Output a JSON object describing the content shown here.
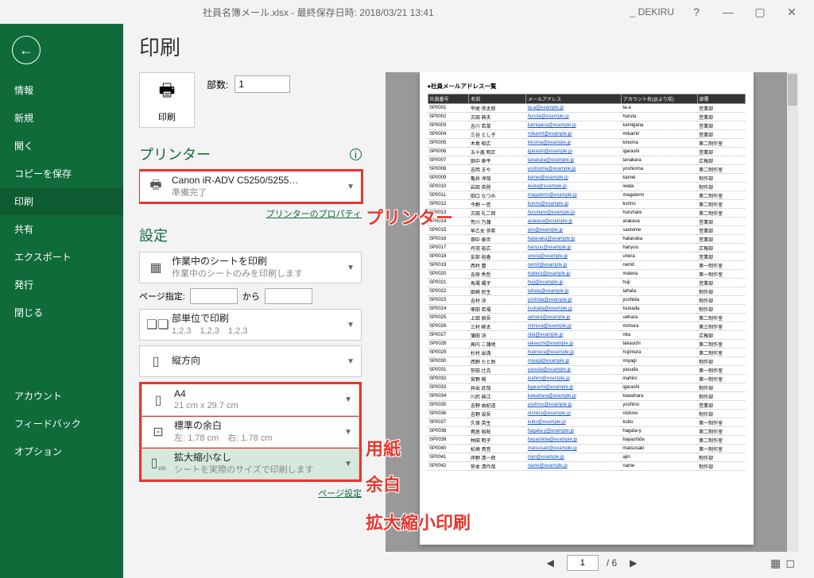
{
  "titlebar": {
    "title": "社員名簿メール.xlsx - 最終保存日時: 2018/03/21 13:41",
    "user": "_ DEKIRU",
    "help": "?"
  },
  "sidebar": {
    "items": [
      "情報",
      "新規",
      "開く",
      "コピーを保存",
      "印刷",
      "共有",
      "エクスポート",
      "発行",
      "閉じる"
    ],
    "bottom": [
      "アカウント",
      "フィードバック",
      "オプション"
    ]
  },
  "page": {
    "title": "印刷",
    "print_btn": "印刷",
    "copies_label": "部数:",
    "copies_value": "1",
    "printer_label": "プリンター",
    "printer": {
      "name": "Canon iR-ADV C5250/5255…",
      "status": "準備完了"
    },
    "printer_props": "プリンターのプロパティ",
    "settings_label": "設定",
    "sheet": {
      "t1": "作業中のシートを印刷",
      "t2": "作業中のシートのみを印刷します"
    },
    "page_spec_label": "ページ指定:",
    "page_spec_to": "から",
    "collate": {
      "t1": "部単位で印刷",
      "t2": "1,2,3　1,2,3　1,2,3"
    },
    "orient": {
      "t1": "縦方向"
    },
    "paper": {
      "t1": "A4",
      "t2": "21 cm x 29.7 cm"
    },
    "margin": {
      "t1": "標準の余白",
      "t2": "左: 1.78 cm　右: 1.78 cm"
    },
    "scale": {
      "t1": "拡大縮小なし",
      "t2": "シートを実際のサイズで印刷します"
    },
    "page_setup": "ページ設定"
  },
  "annotations": {
    "printer": "プリンター",
    "paper": "用紙",
    "margin": "余白",
    "scale": "拡大縮小印刷"
  },
  "preview": {
    "title": "●社員メールアドレス一覧",
    "headers": [
      "社員番号",
      "名前",
      "メールアドレス",
      "アカウント名(@より前)",
      "部署"
    ],
    "rows": [
      [
        "SP0001",
        "平尾 弥太郎",
        "ta-a@example.jp",
        "ta-a",
        "営業部"
      ],
      [
        "SP0002",
        "古田 典夫",
        "huruta@example.jp",
        "huruta",
        "営業部"
      ],
      [
        "SP0003",
        "吉川 若菜",
        "kamigana@example.jp",
        "kamigana",
        "営業部"
      ],
      [
        "SP0004",
        "三谷 とし子",
        "mikamit@example.jp",
        "mikamit",
        "営業部"
      ],
      [
        "SP0005",
        "木島 昭広",
        "kinoma@example.jp",
        "kinoma",
        "第二制作室"
      ],
      [
        "SP0006",
        "五十嵐 明正",
        "igarashi@example.jp",
        "igarashi",
        "営業部"
      ],
      [
        "SP0007",
        "田中 章平",
        "tanakara@example.jp",
        "tanakara",
        "広報部"
      ],
      [
        "SP0008",
        "吉岡 まや",
        "yoshioma@example.jp",
        "yoshioma",
        "第二制作室"
      ],
      [
        "SP0009",
        "亀井 淳哉",
        "kamei@example.jp",
        "kamei",
        "制作部"
      ],
      [
        "SP0010",
        "岩田 英則",
        "iwata@example.jp",
        "iwata",
        "制作部"
      ],
      [
        "SP0011",
        "田口 なつみ",
        "magaterm@example.jp",
        "magaterm",
        "第二制作室"
      ],
      [
        "SP0012",
        "今野 一音",
        "konno@example.jp",
        "konno",
        "第二制作室"
      ],
      [
        "SP0013",
        "古田 礼二郎",
        "huruhare@example.jp",
        "huruhare",
        "第二制作室"
      ],
      [
        "SP0014",
        "荒川 乃蒲",
        "arakava@example.jp",
        "arakava",
        "営業部"
      ],
      [
        "SP0015",
        "早乙女 弥希",
        "yes@example.jp",
        "saotome",
        "営業部"
      ],
      [
        "SP0016",
        "畑中 泰世",
        "hatanaka@example.jp",
        "hatanaka",
        "営業部"
      ],
      [
        "SP0017",
        "丹羽 裕広",
        "hanyuu@example.jp",
        "hanyuu",
        "広報部"
      ],
      [
        "SP0018",
        "安部 裕香",
        "unera@example.jp",
        "unera",
        "営業部"
      ],
      [
        "SP0019",
        "西村 豊",
        "nemit@example.jp",
        "nemit",
        "第一制作室"
      ],
      [
        "SP0020",
        "吉原 秀哲",
        "matera@example.jp",
        "matera",
        "第一制作室"
      ],
      [
        "SP0021",
        "馬場 陽子",
        "huji@example.jp",
        "huji",
        "営業部"
      ],
      [
        "SP0022",
        "田崎 民生",
        "tahata@example.jp",
        "tahata",
        "制作部"
      ],
      [
        "SP0023",
        "吉村 涼",
        "yoshida@example.jp",
        "yoshida",
        "制作部"
      ],
      [
        "SP0024",
        "塚田 若福",
        "tsukada@example.jp",
        "tsukada",
        "制作部"
      ],
      [
        "SP0025",
        "上田 辰吾",
        "uehara@example.jp",
        "uehara",
        "第二制作室"
      ],
      [
        "SP0026",
        "三村 柳太",
        "mimura@example.jp",
        "mimura",
        "第三制作室"
      ],
      [
        "SP0027",
        "蒲田 涼",
        "nita@example.jp",
        "nita",
        "広報部"
      ],
      [
        "SP0028",
        "高内 こ蒲地",
        "takauchi@example.jp",
        "takauchi",
        "第二制作室"
      ],
      [
        "SP0029",
        "杉村 出満",
        "hujimura@example.jp",
        "hujimura",
        "第二制作室"
      ],
      [
        "SP0030",
        "西野 たと助",
        "miyagi@example.jp",
        "miyagi",
        "制作部"
      ],
      [
        "SP0031",
        "笹田 辻克",
        "yasuda@example.jp",
        "yasuda",
        "第一制作室"
      ],
      [
        "SP0032",
        "宮野 務",
        "inahiro@example.jp",
        "inahiro",
        "第一制作室"
      ],
      [
        "SP0033",
        "井出 武哉",
        "iigarashi@example.jp",
        "igarashi",
        "制作部"
      ],
      [
        "SP0034",
        "川尻 典江",
        "kawahara@example.jp",
        "kawahara",
        "制作部"
      ],
      [
        "SP0035",
        "吉野 由紀道",
        "yoshino@example.jp",
        "yoshino",
        "営業部"
      ],
      [
        "SP0036",
        "吉野 竣吾",
        "nishino@example.jp",
        "nishino",
        "制作部"
      ],
      [
        "SP0037",
        "久保 英生",
        "kubo@example.jp",
        "kubo",
        "第一制作室"
      ],
      [
        "SP0038",
        "鳥居 裕秋",
        "hagata-y@example.jp",
        "hagata-y",
        "第二制作室"
      ],
      [
        "SP0039",
        "林田 明子",
        "hayashida@example.jp",
        "hayashida",
        "第二制作室"
      ],
      [
        "SP0040",
        "松崎 貴音",
        "matsusaki@example.jp",
        "matsusaki",
        "第一制作室"
      ],
      [
        "SP0041",
        "岸野 清一郎",
        "mjiri@example.jp",
        "ajiri",
        "制作部"
      ],
      [
        "SP0042",
        "笹本 清作哉",
        "name@example.jp",
        "name",
        "制作部"
      ]
    ]
  },
  "footer": {
    "page": "1",
    "total": "/ 6"
  }
}
